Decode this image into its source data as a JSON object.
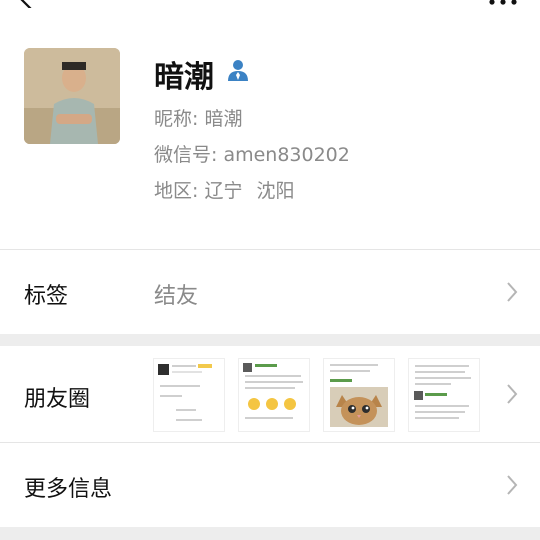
{
  "contact": {
    "name": "暗潮",
    "nickname_line": "昵称: 暗潮",
    "wechat_id_line": "微信号: amen830202",
    "region_label": "地区:",
    "region_province": "辽宁",
    "region_city": "沈阳"
  },
  "rows": {
    "tags_label": "标签",
    "tags_value": "结友",
    "moments_label": "朋友圈",
    "more_info_label": "更多信息"
  },
  "icons": {
    "back": "back-arrow-icon",
    "more": "more-dots-icon",
    "person": "person-icon",
    "chevron": "chevron-right-icon"
  },
  "colors": {
    "accent_blue": "#3b82c4",
    "secondary_text": "#8a8a8a",
    "background": "#ededed"
  }
}
